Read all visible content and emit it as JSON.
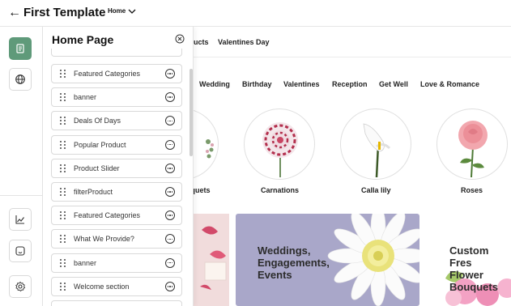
{
  "header": {
    "title": "First Template",
    "page_select": "Home"
  },
  "rail": {
    "items": [
      "page-icon",
      "globe-icon",
      "analytics-icon",
      "widget-icon",
      "settings-icon"
    ]
  },
  "panel": {
    "title": "Home Page",
    "items": [
      "Featured Categories",
      "banner",
      "Deals Of Days",
      "Popular Product",
      "Product Slider",
      "filterProduct",
      "Featured Categories",
      "What We Provide?",
      "banner",
      "Welcome section"
    ]
  },
  "preview": {
    "nav_top": [
      "ucts",
      "Valentines Day"
    ],
    "chips": [
      "Wedding",
      "Birthday",
      "Valentines",
      "Reception",
      "Get Well",
      "Love & Romance"
    ],
    "categories": [
      "uquets",
      "Carnations",
      "Calla lily",
      "Roses"
    ],
    "banners": [
      {
        "text": "Weddings,\nEngagements,\nEvents"
      },
      {
        "text": "Custom Fres\nFlower\nBouquets"
      }
    ]
  },
  "colors": {
    "accent": "#5f9a7a",
    "banner_purple": "#a9a7c9",
    "banner_pink": "#f3d7da"
  }
}
